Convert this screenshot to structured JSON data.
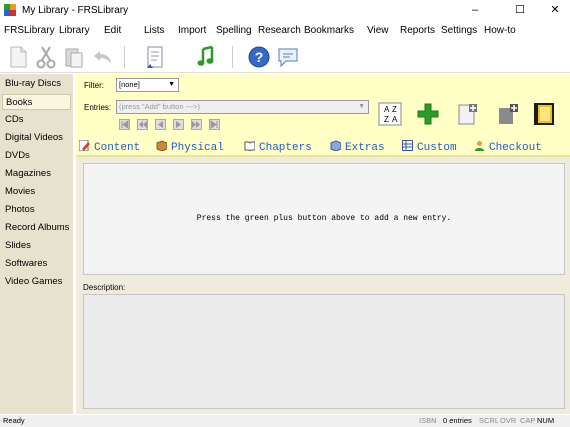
{
  "window": {
    "title": "My Library - FRSLibrary",
    "min_glyph": "–",
    "max_glyph": "☐",
    "close_glyph": "✕"
  },
  "menu": [
    "FRSLibrary",
    "Library",
    "Edit",
    "Lists",
    "Import",
    "Spelling",
    "Research",
    "Bookmarks",
    "View",
    "Reports",
    "Settings",
    "How-to"
  ],
  "toolbar": {
    "icons": [
      "new-document-icon",
      "cut-icon",
      "paste-icon",
      "undo-icon",
      "book-reader-icon",
      "music-note-icon",
      "help-icon",
      "chat-bubble-icon"
    ]
  },
  "sidebar": {
    "items": [
      "Blu-ray Discs",
      "Books",
      "CDs",
      "Digital Videos",
      "DVDs",
      "Magazines",
      "Movies",
      "Photos",
      "Record Albums",
      "Slides",
      "Softwares",
      "Video Games"
    ],
    "selected": "Books"
  },
  "form": {
    "filter_label": "Filter:",
    "filter_value": "[none]",
    "entries_label": "Entries:",
    "entries_value": "(press \"Add\" button --->)",
    "sort_icon_text": [
      "A",
      "Z",
      "Z",
      "A"
    ]
  },
  "tabs": [
    {
      "label": "Content",
      "icon": "edit-icon"
    },
    {
      "label": "Physical",
      "icon": "box-icon"
    },
    {
      "label": "Chapters",
      "icon": "book-icon"
    },
    {
      "label": "Extras",
      "icon": "cube-icon"
    },
    {
      "label": "Custom",
      "icon": "table-icon"
    },
    {
      "label": "Checkout",
      "icon": "person-icon"
    }
  ],
  "main": {
    "empty_message": "Press the green plus button above to add a new entry.",
    "description_label": "Description:"
  },
  "status": {
    "left": "Ready",
    "isbn": "ISBN",
    "entries": "0 entries",
    "scrl": "SCRL",
    "ovr": "OVR",
    "cap": "CAP",
    "num": "NUM"
  },
  "colors": {
    "form_bg": "#ffffc6",
    "sidebar_bg": "#e7e2cd",
    "tab_text": "#2060cc",
    "add_green": "#2a9c2a"
  }
}
